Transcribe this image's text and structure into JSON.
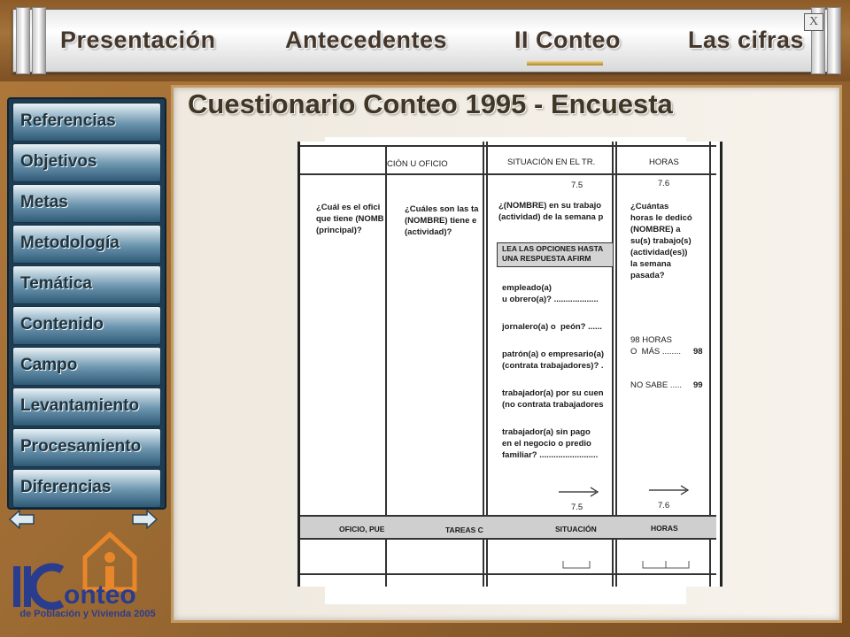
{
  "nav": {
    "tabs": [
      "Presentación",
      "Antecedentes",
      "II Conteo",
      "Las cifras"
    ],
    "active": "II Conteo",
    "close_label": "X"
  },
  "sidebar": {
    "items": [
      "Referencias",
      "Objetivos",
      "Metas",
      "Metodología",
      "Temática",
      "Contenido",
      "Campo",
      "Levantamiento",
      "Procesamiento",
      "Diferencias"
    ]
  },
  "title": "Cuestionario Conteo 1995 - Encuesta",
  "logo": {
    "text": "II Conteo",
    "tagline": "de Población y Vivienda 2005"
  },
  "questionnaire": {
    "col1_header": "CIÓN U OFICIO",
    "col1_q": "¿Cuál es el ofici\nque tiene (NOMB\n(principal)?",
    "col2_q": "¿Cuáles son las ta\n(NOMBRE) tiene e\n(actividad)?",
    "col3_header": "SITUACIÓN  EN  EL  TR.",
    "col3_num": "7.5",
    "col3_q": "¿(NOMBRE) en su trabajo\n(actividad) de la semana p",
    "col3_box": "LEA LAS OPCIONES HASTA\nUNA RESPUESTA AFIRM",
    "col3_options": [
      "empleado(a)\nu obrero(a)? ...................",
      "jornalero(a) o  peón? ......",
      "patrón(a) o empresario(a)\n(contrata trabajadores)? .",
      "trabajador(a) por su cuen\n(no contrata trabajadores",
      "trabajador(a) sin pago\nen el negocio o predio\nfamiliar? ........................."
    ],
    "col3_arrow_num": "7.5",
    "col4_header": "HORAS",
    "col4_num": "7.6",
    "col4_q": "¿Cuántas\nhoras le dedicó\n(NOMBRE) a\nsu(s) trabajo(s)\n(actividad(es))\nla semana\npasada?",
    "col4_opt1": "98 HORAS\nO  MÁS ........",
    "col4_opt1_code": "98",
    "col4_opt2": "NO SABE .....",
    "col4_opt2_code": "99",
    "col4_arrow_num": "7.6",
    "footer": [
      "OFICIO, PUE",
      "TAREAS C",
      "SITUACIÓN",
      "HORAS"
    ]
  },
  "colors": {
    "frame": "#a4733b",
    "sidebar": "#1f3d52",
    "title": "#3f3626"
  }
}
